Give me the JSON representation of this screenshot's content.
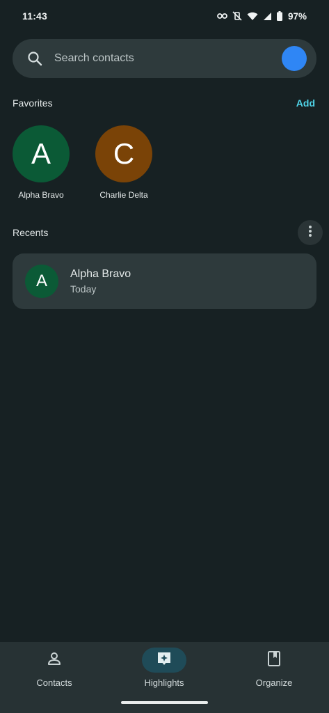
{
  "status_bar": {
    "time": "11:43",
    "battery_percent": "97%",
    "icons": [
      "vpn-key-icon",
      "vibrate-off-icon",
      "wifi-icon",
      "signal-icon",
      "battery-icon"
    ]
  },
  "search": {
    "placeholder": "Search contacts",
    "value": "",
    "avatar_color": "#2f86f5"
  },
  "favorites": {
    "title": "Favorites",
    "add_label": "Add",
    "items": [
      {
        "initial": "A",
        "name": "Alpha Bravo",
        "color": "#0b5a36"
      },
      {
        "initial": "C",
        "name": "Charlie Delta",
        "color": "#7a4307"
      }
    ]
  },
  "recents": {
    "title": "Recents",
    "items": [
      {
        "initial": "A",
        "name": "Alpha Bravo",
        "subtitle": "Today",
        "color": "#0b5a36"
      }
    ]
  },
  "bottom_nav": {
    "items": [
      {
        "label": "Contacts",
        "icon": "person-icon",
        "active": false
      },
      {
        "label": "Highlights",
        "icon": "highlights-sparkle-icon",
        "active": true
      },
      {
        "label": "Organize",
        "icon": "bookmark-book-icon",
        "active": false
      }
    ]
  },
  "colors": {
    "background": "#172123",
    "surface": "#2e3a3c",
    "accent": "#4fd4e8",
    "nav_active": "#1f4b58"
  }
}
